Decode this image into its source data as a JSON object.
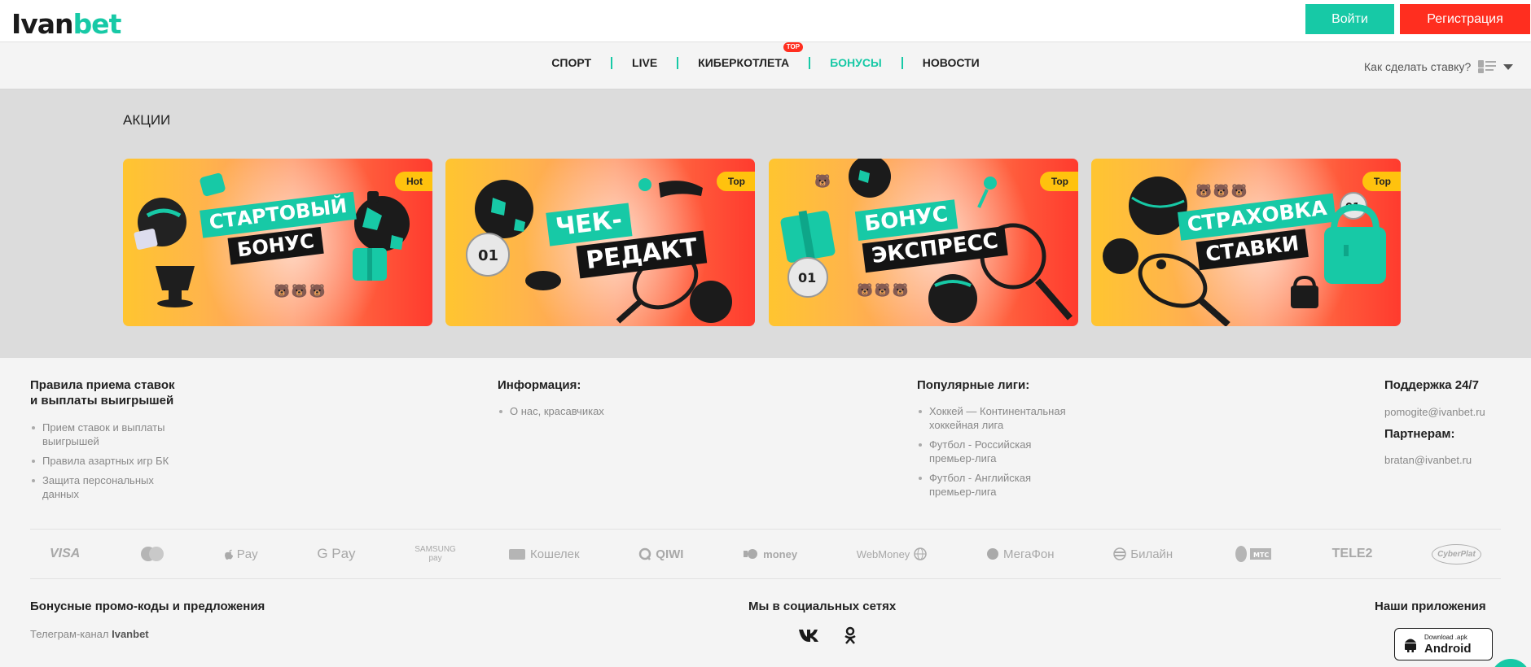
{
  "header": {
    "logo_part1": "Ivan",
    "logo_part2": "bet",
    "login_label": "Войти",
    "register_label": "Регистрация"
  },
  "nav": {
    "items": [
      {
        "label": "СПОРТ"
      },
      {
        "label": "LIVE"
      },
      {
        "label": "КИБЕРКОТЛЕТА",
        "badge": "TOP"
      },
      {
        "label": "БОНУСЫ"
      },
      {
        "label": "НОВОСТИ"
      }
    ],
    "how_to_bet": "Как сделать ставку?"
  },
  "promos": {
    "title": "АКЦИИ",
    "cards": [
      {
        "badge": "Hot",
        "line1": "СТАРТОВЫЙ",
        "line2": "БОНУС"
      },
      {
        "badge": "Top",
        "line1": "ЧЕК-",
        "line2": "РЕДАКТ"
      },
      {
        "badge": "Top",
        "line1": "БОНУС",
        "line2": "ЭКСПРЕСС"
      },
      {
        "badge": "Top",
        "line1": "СТРАХОВКА",
        "line2": "СТАВКИ"
      }
    ]
  },
  "footer": {
    "rules": {
      "title_line1": "Правила приема ставок",
      "title_line2": "и выплаты выигрышей",
      "items": [
        {
          "line1": "Прием ставок и выплаты",
          "line2": "выигрышей"
        },
        {
          "line1": "Правила азартных игр БК",
          "line2": ""
        },
        {
          "line1": "Защита персональных",
          "line2": "данных"
        }
      ]
    },
    "info": {
      "title": "Информация:",
      "items": [
        "О нас, красавчиках"
      ]
    },
    "leagues": {
      "title": "Популярные лиги:",
      "items": [
        {
          "line1": "Хоккей — Континентальная",
          "line2": "хоккейная лига"
        },
        {
          "line1": "Футбол - Российская",
          "line2": "премьер-лига"
        },
        {
          "line1": "Футбол - Английская",
          "line2": "премьер-лига"
        }
      ]
    },
    "support": {
      "title": "Поддержка 24/7",
      "email": "pomogite@ivanbet.ru",
      "partners_title": "Партнерам:",
      "partners_email": "bratan@ivanbet.ru"
    },
    "payments": [
      "VISA",
      "",
      "Pay",
      "G Pay",
      "SAMSUNG pay",
      "Кошелек",
      "QIWI",
      "money",
      "WebMoney",
      "МегаФон",
      "Билайн",
      "МТС",
      "TELE2",
      "CyberPlat"
    ],
    "promo_codes": {
      "title": "Бонусные промо-коды и предложения",
      "telegram_prefix": "Телеграм-канал ",
      "telegram_name": "Ivanbet"
    },
    "social": {
      "title": "Мы в социальных сетях",
      "vk": "vk",
      "ok": "ok"
    },
    "apps": {
      "title": "Наши приложения",
      "android_small": "Download .apk",
      "android_big": "Android"
    }
  },
  "colors": {
    "accent": "#17c9a6",
    "register": "#ff2e1f",
    "badge": "#ffc20e"
  }
}
